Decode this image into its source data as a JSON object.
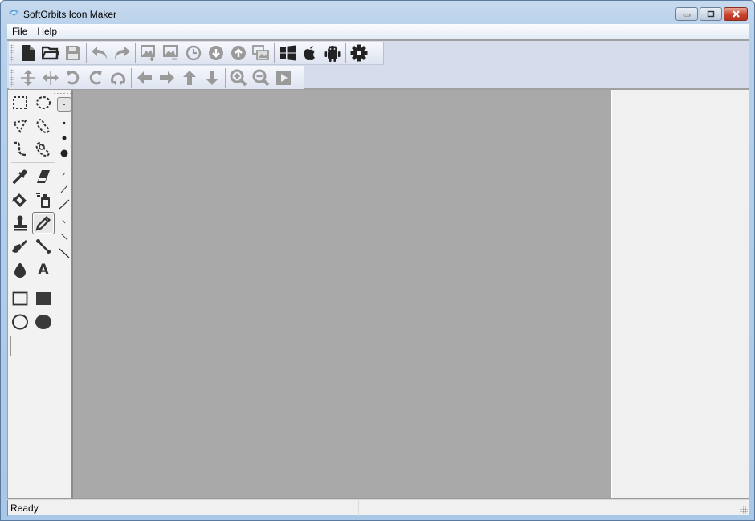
{
  "window": {
    "title": "SoftOrbits Icon Maker",
    "controls": {
      "minimize": "minimize-icon",
      "maximize": "maximize-icon",
      "close": "close-icon"
    }
  },
  "menu": {
    "items": [
      {
        "label": "File"
      },
      {
        "label": "Help"
      }
    ]
  },
  "toolbar_main": {
    "buttons": [
      {
        "name": "new",
        "icon": "new-file-icon",
        "enabled": true
      },
      {
        "name": "open",
        "icon": "open-folder-icon",
        "enabled": true
      },
      {
        "name": "save",
        "icon": "save-icon",
        "enabled": false
      },
      {
        "name": "undo",
        "icon": "undo-icon",
        "enabled": false
      },
      {
        "name": "redo",
        "icon": "redo-icon",
        "enabled": false
      },
      {
        "name": "add-image",
        "icon": "add-image-icon",
        "enabled": false
      },
      {
        "name": "remove-image",
        "icon": "remove-image-icon",
        "enabled": false
      },
      {
        "name": "history",
        "icon": "clock-icon",
        "enabled": false
      },
      {
        "name": "move-down",
        "icon": "circle-down-icon",
        "enabled": false
      },
      {
        "name": "move-up",
        "icon": "circle-up-icon",
        "enabled": false
      },
      {
        "name": "images",
        "icon": "images-icon",
        "enabled": false
      },
      {
        "name": "windows",
        "icon": "windows-icon",
        "enabled": true
      },
      {
        "name": "apple",
        "icon": "apple-icon",
        "enabled": true
      },
      {
        "name": "android",
        "icon": "android-icon",
        "enabled": true
      },
      {
        "name": "settings",
        "icon": "gear-icon",
        "enabled": true
      }
    ]
  },
  "toolbar_edit": {
    "buttons": [
      {
        "name": "flip-vertical",
        "icon": "flip-vertical-icon",
        "enabled": false
      },
      {
        "name": "flip-horizontal",
        "icon": "flip-horizontal-icon",
        "enabled": false
      },
      {
        "name": "rotate-left",
        "icon": "rotate-left-icon",
        "enabled": false
      },
      {
        "name": "rotate-right",
        "icon": "rotate-right-icon",
        "enabled": false
      },
      {
        "name": "rotate-180",
        "icon": "rotate-180-icon",
        "enabled": false
      },
      {
        "name": "shift-left",
        "icon": "arrow-left-icon",
        "enabled": false
      },
      {
        "name": "shift-right",
        "icon": "arrow-right-icon",
        "enabled": false
      },
      {
        "name": "shift-up",
        "icon": "arrow-up-icon",
        "enabled": false
      },
      {
        "name": "shift-down",
        "icon": "arrow-down-icon",
        "enabled": false
      },
      {
        "name": "zoom-in",
        "icon": "zoom-in-icon",
        "enabled": false
      },
      {
        "name": "zoom-out",
        "icon": "zoom-out-icon",
        "enabled": false
      },
      {
        "name": "preview",
        "icon": "play-icon",
        "enabled": false
      }
    ]
  },
  "toolbox": {
    "tools": [
      {
        "name": "rect-select",
        "icon": "rect-select-icon"
      },
      {
        "name": "ellipse-select",
        "icon": "ellipse-select-icon"
      },
      {
        "name": "polygon-select",
        "icon": "polygon-select-icon"
      },
      {
        "name": "lasso-select",
        "icon": "lasso-select-icon"
      },
      {
        "name": "magic-wand",
        "icon": "magic-wand-icon"
      },
      {
        "name": "color-select",
        "icon": "color-select-icon"
      },
      {
        "name": "eyedropper",
        "icon": "eyedropper-icon"
      },
      {
        "name": "eraser",
        "icon": "eraser-icon"
      },
      {
        "name": "fill",
        "icon": "paint-bucket-icon"
      },
      {
        "name": "spray",
        "icon": "spray-can-icon"
      },
      {
        "name": "stamp",
        "icon": "stamp-icon"
      },
      {
        "name": "pencil",
        "icon": "pencil-icon",
        "selected": true
      },
      {
        "name": "brush",
        "icon": "brush-icon"
      },
      {
        "name": "line",
        "icon": "line-icon"
      },
      {
        "name": "blur",
        "icon": "drop-icon"
      },
      {
        "name": "text",
        "icon": "text-icon",
        "glyph": "A"
      },
      {
        "name": "rectangle",
        "icon": "rectangle-outline-icon"
      },
      {
        "name": "filled-rectangle",
        "icon": "rectangle-filled-icon"
      },
      {
        "name": "ellipse",
        "icon": "ellipse-outline-icon"
      },
      {
        "name": "filled-ellipse",
        "icon": "ellipse-filled-icon"
      }
    ],
    "brush_sizes": [
      "1px",
      "2px",
      "4px",
      "8px"
    ],
    "line_widths": [
      "1",
      "2",
      "3",
      "4",
      "5",
      "6"
    ]
  },
  "status": {
    "text": "Ready",
    "panel2": "",
    "panel3": ""
  }
}
